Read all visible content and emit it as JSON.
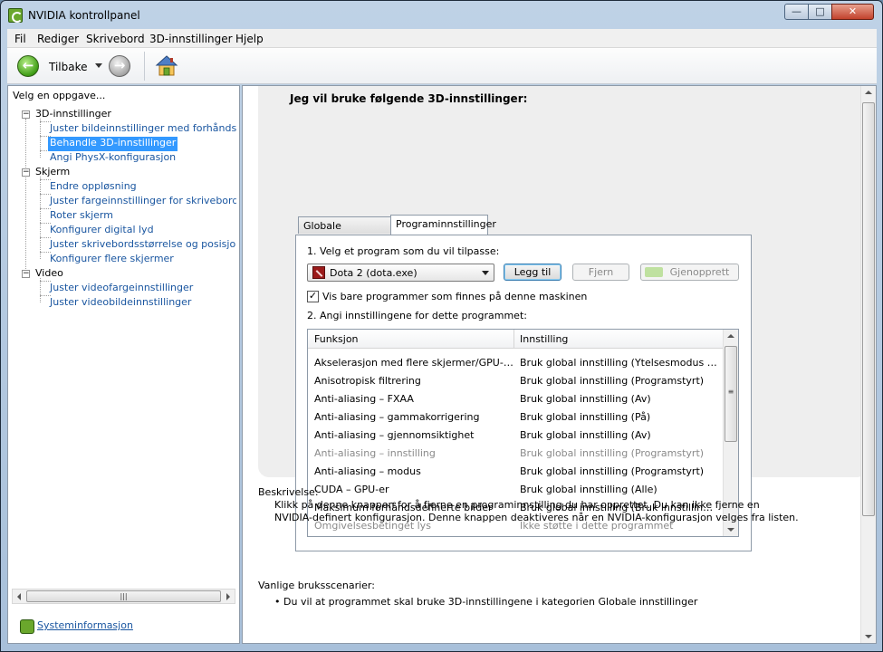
{
  "window": {
    "title": "NVIDIA kontrollpanel"
  },
  "menu": [
    "Fil",
    "Rediger",
    "Skrivebord",
    "3D-innstillinger",
    "Hjelp"
  ],
  "toolbar": {
    "back_label": "Tilbake"
  },
  "left_panel": {
    "heading": "Velg en oppgave...",
    "groups": [
      {
        "label": "3D-innstillinger",
        "items": [
          "Juster bildeinnstillinger med forhåndsvisning",
          "Behandle 3D-innstillinger",
          "Angi PhysX-konfigurasjon"
        ]
      },
      {
        "label": "Skjerm",
        "items": [
          "Endre oppløsning",
          "Juster fargeinnstillinger for skrivebordet",
          "Roter skjerm",
          "Konfigurer digital lyd",
          "Juster skrivebordsstørrelse og posisjon",
          "Konfigurer flere skjermer"
        ]
      },
      {
        "label": "Video",
        "items": [
          "Juster videofargeinnstillinger",
          "Juster videobildeinnstillinger"
        ]
      }
    ],
    "selected_item": "Behandle 3D-innstillinger",
    "system_info_label": "Systeminformasjon"
  },
  "main": {
    "section_title": "Jeg vil bruke følgende 3D-innstillinger:",
    "tabs": [
      {
        "label": "Globale innstillinger",
        "active": false
      },
      {
        "label": "Programinnstillinger",
        "active": true
      }
    ],
    "step1_label": "1. Velg et program som du vil tilpasse:",
    "program_select_value": "Dota 2 (dota.exe)",
    "add_button": "Legg til",
    "remove_button": "Fjern",
    "restore_button": "Gjenopprett",
    "filter_checkbox_label": "Vis bare programmer som finnes på denne maskinen",
    "filter_checked": true,
    "step2_label": "2. Angi innstillingene for dette programmet:",
    "list_columns": [
      "Funksjon",
      "Innstilling"
    ],
    "list_rows": [
      {
        "function": "Akselerasjon med flere skjermer/GPU-typer",
        "setting": "Bruk global innstilling (Ytelsesmodus for fle...",
        "disabled": false
      },
      {
        "function": "Anisotropisk filtrering",
        "setting": "Bruk global innstilling (Programstyrt)",
        "disabled": false
      },
      {
        "function": "Anti-aliasing – FXAA",
        "setting": "Bruk global innstilling (Av)",
        "disabled": false
      },
      {
        "function": "Anti-aliasing – gammakorrigering",
        "setting": "Bruk global innstilling (På)",
        "disabled": false
      },
      {
        "function": "Anti-aliasing – gjennomsiktighet",
        "setting": "Bruk global innstilling (Av)",
        "disabled": false
      },
      {
        "function": "Anti-aliasing – innstilling",
        "setting": "Bruk global innstilling (Programstyrt)",
        "disabled": true
      },
      {
        "function": "Anti-aliasing – modus",
        "setting": "Bruk global innstilling (Programstyrt)",
        "disabled": false
      },
      {
        "function": "CUDA – GPU-er",
        "setting": "Bruk global innstilling (Alle)",
        "disabled": false
      },
      {
        "function": "Maksimum forhåndsdefinerte bilder",
        "setting": "Bruk global innstilling (Bruk innstillingen for ...",
        "disabled": false
      },
      {
        "function": "Omgivelsesbetinget lys",
        "setting": "Ikke støtte i dette programmet",
        "disabled": true
      }
    ],
    "description_heading": "Beskrivelse:",
    "description_text": "Klikk på denne knappen for å fjerne en programinnstilling du har opprettet. Du kan ikke fjerne en NVIDIA-definert konfigurasjon. Denne knappen deaktiveres når en NVIDIA-konfigurasjon velges fra listen.",
    "scenarios_heading": "Vanlige bruksscenarier:",
    "scenarios": [
      "Du vil at programmet skal bruke 3D-innstillingene i kategorien Globale innstillinger"
    ]
  },
  "icons": {
    "app": "nvidia-logo-icon",
    "back": "back-arrow-icon",
    "forward": "forward-arrow-icon",
    "home": "home-icon",
    "program": "dota2-icon",
    "system_info": "nvidia-logo-icon"
  },
  "colors": {
    "link": "#1a56a0",
    "selection": "#3399ff",
    "nvidia_green": "#6aa72c"
  }
}
